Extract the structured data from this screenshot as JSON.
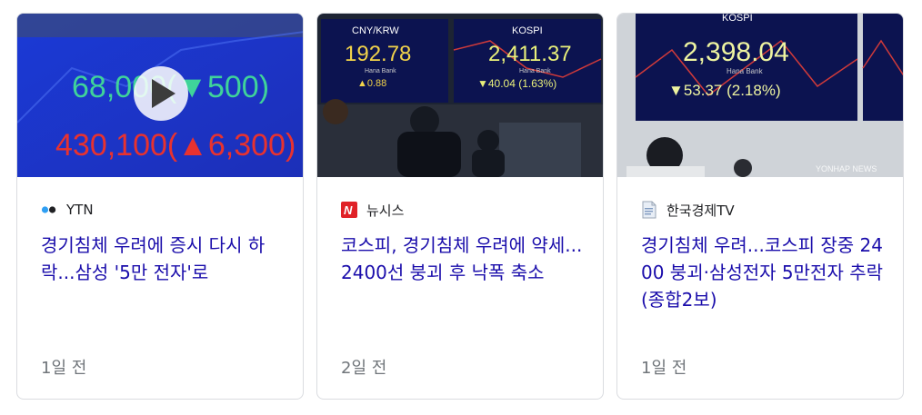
{
  "cards": [
    {
      "source": "YTN",
      "source_icon": "ytn-logo-icon",
      "headline": "경기침체 우려에 증시 다시 하락...삼성 '5만 전자'로",
      "age": "1일 전",
      "thumbnail": {
        "line1": "68,000(▼500)",
        "line2": "430,100(▲6,300)",
        "has_play_button": true
      }
    },
    {
      "source": "뉴시스",
      "source_icon": "newsis-logo-icon",
      "headline": "코스피, 경기침체 우려에 약세...2400선 붕괴 후 낙폭 축소",
      "age": "2일 전",
      "thumbnail": {
        "board1_label": "CNY/KRW",
        "board1_value": "192.78",
        "board1_bank": "Hana Bank",
        "board1_change": "▲0.88",
        "board2_label": "KOSPI",
        "board2_value": "2,411.37",
        "board2_bank": "Hana Bank",
        "board2_change": "▼40.04 (1.63%)"
      }
    },
    {
      "source": "한국경제TV",
      "source_icon": "generic-document-icon",
      "headline": "경기침체 우려...코스피 장중 2400 붕괴·삼성전자 5만전자 추락(종합2보)",
      "age": "1일 전",
      "thumbnail": {
        "board_label": "KOSPI",
        "board_value": "2,398.04",
        "board_bank": "Hana Bank",
        "board_change": "▼53.37 (2.18%)",
        "watermark": "YONHAP NEWS"
      }
    }
  ],
  "colors": {
    "headline": "#1a0dab",
    "meta": "#70757a",
    "border": "#dadce0",
    "ticker_green": "#3fd39a",
    "ticker_red": "#e8322f"
  }
}
